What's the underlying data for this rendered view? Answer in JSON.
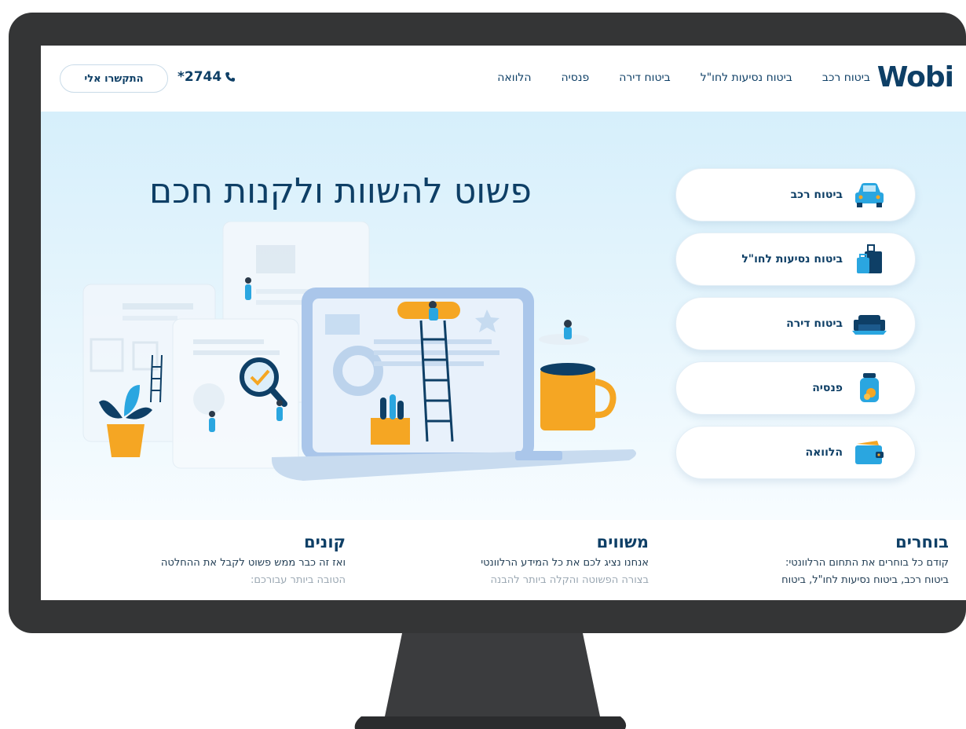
{
  "header": {
    "logo_text": "Wobi",
    "nav": [
      "ביטוח רכב",
      "ביטוח נסיעות לחו\"ל",
      "ביטוח דירה",
      "פנסיה",
      "הלוואה"
    ],
    "phone": "*2744",
    "contact_button": "התקשרו אלי"
  },
  "hero": {
    "title": "פשוט להשוות ולקנות חכם",
    "categories": [
      {
        "label": "ביטוח רכב",
        "icon": "car-icon"
      },
      {
        "label": "ביטוח נסיעות לחו\"ל",
        "icon": "luggage-icon"
      },
      {
        "label": "ביטוח דירה",
        "icon": "sofa-icon"
      },
      {
        "label": "פנסיה",
        "icon": "jar-icon"
      },
      {
        "label": "הלוואה",
        "icon": "wallet-icon"
      }
    ]
  },
  "steps": [
    {
      "title": "בוחרים",
      "line1": "קודם כל בוחרים את התחום הרלוונטי:",
      "line2": "ביטוח רכב, ביטוח נסיעות לחו\"ל, ביטוח"
    },
    {
      "title": "משווים",
      "line1": "אנחנו נציג לכם את כל המידע הרלוונטי",
      "line2": "בצורה הפשוטה והקלה ביותר להבנה"
    },
    {
      "title": "קונים",
      "line1": "ואז זה כבר ממש פשוט לקבל את ההחלטה",
      "line2": "הטובה ביותר עבורכם:"
    }
  ],
  "colors": {
    "brand": "#0e3f66",
    "accent_blue": "#2aa6e0",
    "accent_orange": "#f5a623",
    "bezel": "#343536"
  }
}
